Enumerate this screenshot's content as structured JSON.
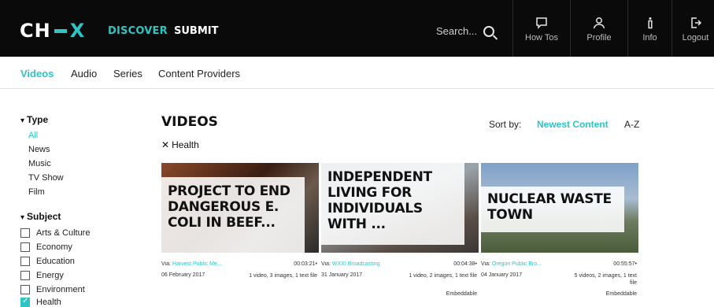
{
  "topbar": {
    "logo_left": "CH",
    "logo_right": "X",
    "discover": "DISCOVER",
    "submit": "SUBMIT",
    "search_placeholder": "Search...",
    "buttons": [
      {
        "label": "How Tos",
        "icon": "chat-bubble-icon"
      },
      {
        "label": "Profile",
        "icon": "person-icon"
      },
      {
        "label": "Info",
        "icon": "info-icon"
      },
      {
        "label": "Logout",
        "icon": "logout-icon"
      }
    ]
  },
  "subnav": {
    "tabs": [
      "Videos",
      "Audio",
      "Series",
      "Content Providers"
    ],
    "active": "Videos"
  },
  "sidebar": {
    "type_heading": "Type",
    "type_items": [
      "All",
      "News",
      "Music",
      "TV Show",
      "Film"
    ],
    "type_selected": "All",
    "subject_heading": "Subject",
    "subject_items": [
      {
        "label": "Arts & Culture",
        "checked": false
      },
      {
        "label": "Economy",
        "checked": false
      },
      {
        "label": "Education",
        "checked": false
      },
      {
        "label": "Energy",
        "checked": false
      },
      {
        "label": "Environment",
        "checked": false
      },
      {
        "label": "Health",
        "checked": true
      }
    ]
  },
  "main": {
    "title": "VIDEOS",
    "filter_chip": "Health",
    "sort_label": "Sort by:",
    "sort_newest": "Newest Content",
    "sort_az": "A-Z",
    "accent": "#2ec4c4",
    "cards": [
      {
        "title": "PROJECT TO END DANGEROUS E. COLI IN BEEF...",
        "via_prefix": "Via:",
        "via_source": "Harvest Public Me...",
        "date": "06 February 2017",
        "duration": "00:03:21•",
        "files": "1 video, 3 images, 1 text file",
        "embeddable": ""
      },
      {
        "title": "INDEPENDENT LIVING FOR INDIVIDUALS WITH ...",
        "via_prefix": "Via:",
        "via_source": "WXXI Broadcasting",
        "date": "31 January 2017",
        "duration": "00:04:38•",
        "files": "1 video, 2 images, 1 text file",
        "embeddable": "Embeddable"
      },
      {
        "title": "NUCLEAR WASTE TOWN",
        "via_prefix": "Via:",
        "via_source": "Oregon Public Bro...",
        "date": "04 January 2017",
        "duration": "00:55:57•",
        "files": "5 videos, 2 images, 1 text file",
        "embeddable": "Embeddable"
      }
    ]
  }
}
